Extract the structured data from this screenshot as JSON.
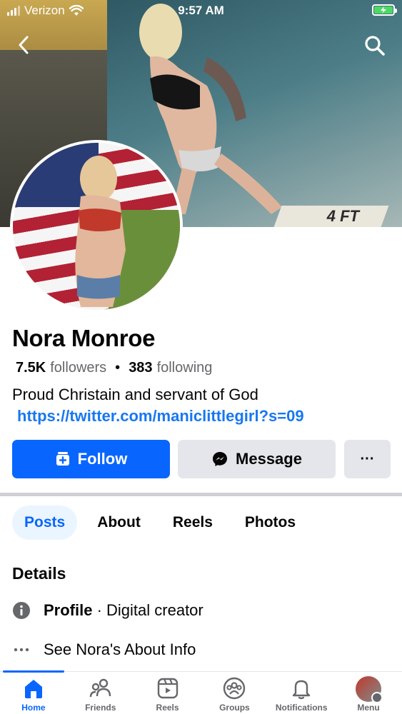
{
  "status_bar": {
    "carrier": "Verizon",
    "time": "9:57 AM"
  },
  "profile": {
    "name": "Nora Monroe",
    "followers_count": "7.5K",
    "followers_label": "followers",
    "separator": "•",
    "following_count": "383",
    "following_label": "following",
    "bio": "Proud Christain and servant of God",
    "link": "https://twitter.com/maniclittlegirl?s=09"
  },
  "cover": {
    "pool_sign": "4 FT"
  },
  "actions": {
    "follow_label": "Follow",
    "message_label": "Message",
    "more_label": "···"
  },
  "tabs": [
    {
      "label": "Posts",
      "active": true
    },
    {
      "label": "About",
      "active": false
    },
    {
      "label": "Reels",
      "active": false
    },
    {
      "label": "Photos",
      "active": false
    }
  ],
  "details": {
    "title": "Details",
    "profile_label": "Profile",
    "profile_value": " · Digital creator",
    "about_link": "See Nora's About Info"
  },
  "nav": [
    {
      "label": "Home",
      "icon": "home-icon",
      "active": true
    },
    {
      "label": "Friends",
      "icon": "friends-icon",
      "active": false
    },
    {
      "label": "Reels",
      "icon": "reels-icon",
      "active": false
    },
    {
      "label": "Groups",
      "icon": "groups-icon",
      "active": false
    },
    {
      "label": "Notifications",
      "icon": "bell-icon",
      "active": false
    },
    {
      "label": "Menu",
      "icon": "avatar-icon",
      "active": false
    }
  ],
  "colors": {
    "accent": "#0866ff",
    "link": "#1877f2",
    "secondary_button": "#e4e6eb",
    "muted_text": "#65676b"
  }
}
